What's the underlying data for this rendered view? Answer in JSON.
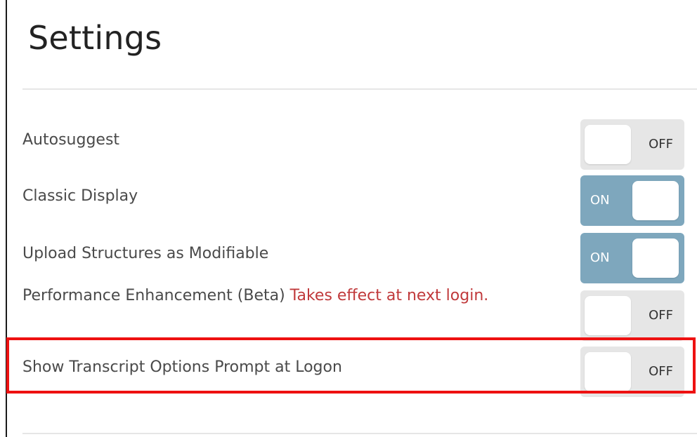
{
  "page": {
    "title": "Settings"
  },
  "settings": [
    {
      "label": "Autosuggest",
      "note": "",
      "state": "OFF",
      "on": false
    },
    {
      "label": "Classic Display",
      "note": "",
      "state": "ON",
      "on": true
    },
    {
      "label": "Upload Structures as Modifiable",
      "note": "",
      "state": "ON",
      "on": true
    },
    {
      "label": "Performance Enhancement (Beta) ",
      "note": "Takes effect at next login.",
      "state": "OFF",
      "on": false
    },
    {
      "label": "Show Transcript Options Prompt at Logon",
      "note": "",
      "state": "OFF",
      "on": false
    }
  ],
  "colors": {
    "toggle_on": "#7ea7bd",
    "toggle_off": "#e6e6e6",
    "note_red": "#c0393b",
    "highlight": "#ee1111"
  }
}
